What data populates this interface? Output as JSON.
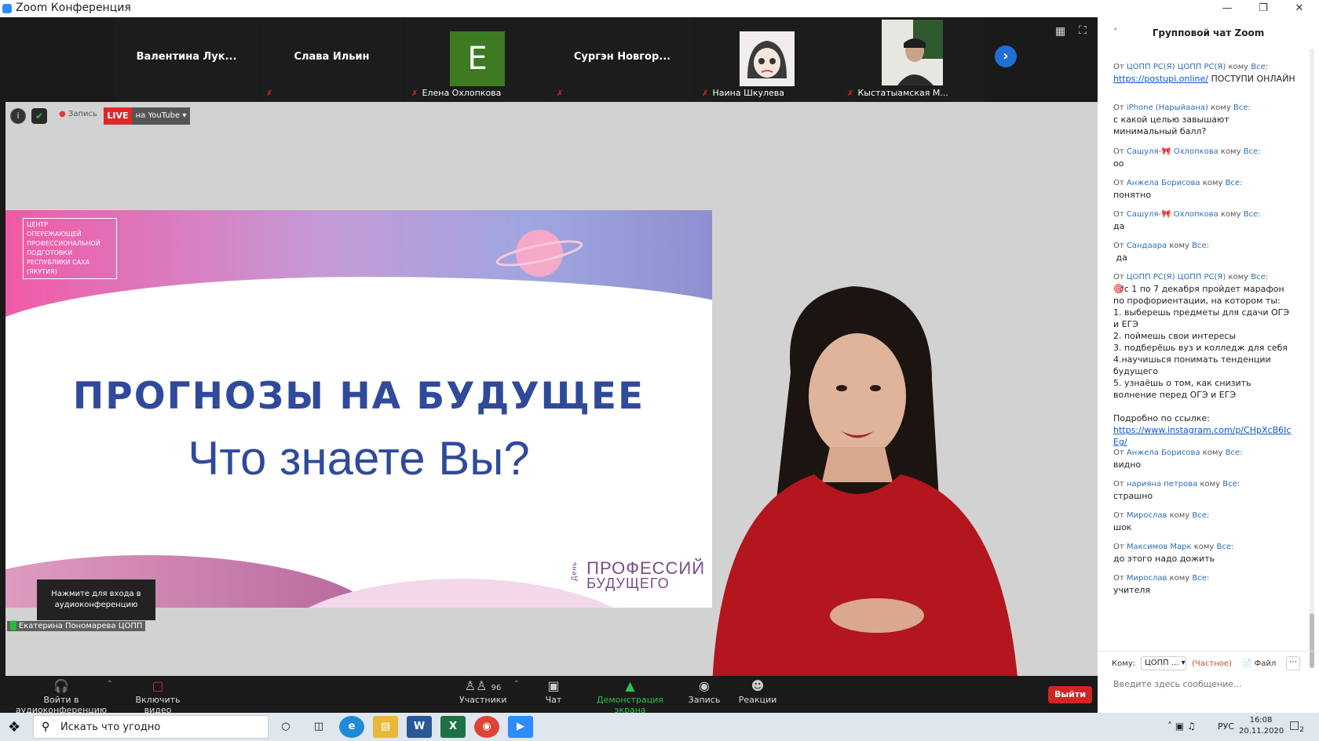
{
  "window": {
    "title": "Zoom Конференция"
  },
  "participants": [
    {
      "name": "Валентина Лук...",
      "label": "",
      "muted": false
    },
    {
      "name": "Слава Ильин",
      "label": "",
      "muted": true
    },
    {
      "name": "",
      "label": "Елена Охлопкова",
      "avatar_letter": "E",
      "muted": true
    },
    {
      "name": "Сургэн Новгор...",
      "label": "",
      "muted": true
    },
    {
      "name": "",
      "label": "Наина Шкулева",
      "muted": true
    },
    {
      "name": "",
      "label": "Кыстатыамская М...",
      "muted": true
    }
  ],
  "meeting_bar": {
    "record_label": "Запись",
    "live_label": "LIVE",
    "live_target": "на YouTube"
  },
  "slide": {
    "title": "ПРОГНОЗЫ НА БУДУЩЕЕ",
    "subtitle": "Что знаете Вы?",
    "logo_line1": "ПРОФЕССИЙ",
    "logo_line2": "БУДУЩЕГО",
    "logo_tag": "День"
  },
  "audio_tip": "Нажмите для входа в аудиоконференцию",
  "speaker_name": "Екатерина Пономарева ЦОПП",
  "toolbar": {
    "join_audio": "Войти в аудиоконференцию",
    "start_video": "Включить видео",
    "participants": "Участники",
    "participants_count": "96",
    "chat": "Чат",
    "share": "Демонстрация экрана",
    "record": "Запись",
    "reactions": "Реакции",
    "leave": "Выйти"
  },
  "chat": {
    "title": "Групповой чат Zoom",
    "to_label": "Кому:",
    "to_value": "ЦОПП ...",
    "private_label": "(Частное)",
    "file_label": "Файл",
    "placeholder": "Введите здесь сообщение...",
    "messages": [
      {
        "from": "ЦОПП РС(Я) ЦОПП РС(Я)",
        "link": "https://postupi.online/",
        "text": " ПОСТУПИ ОНЛАЙН"
      },
      {
        "from": "iPhone (Нарыйаана)",
        "text": "с какой целью завышают минимальный балл?"
      },
      {
        "from": "Сашуля-🎀 Охлопкова",
        "text": "оо"
      },
      {
        "from": "Анжела Борисова",
        "text": "понятно"
      },
      {
        "from": "Сашуля-🎀 Охлопкова",
        "text": "да"
      },
      {
        "from": "Сандаара",
        "text": " да"
      },
      {
        "from": "ЦОПП РС(Я) ЦОПП РС(Я)",
        "text": "🎯с 1 по 7 декабря пройдет марафон по профориентации, на котором ты:\n1. выберешь предметы для сдачи ОГЭ и ЕГЭ\n2. поймешь свои интересы\n3. подберёшь вуз и колледж для себя\n4.научишься понимать тенденции будущего\n5. узнаёшь о том, как снизить волнение перед ОГЭ и ЕГЭ\n\nПодробно по ссылке:",
        "link": "https://www.instagram.com/p/CHpXcB6IcEg/"
      },
      {
        "from": "Анжела Борисова",
        "text": "видно"
      },
      {
        "from": "нарияна петрова",
        "text": "страшно"
      },
      {
        "from": "Мирослав",
        "text": "шок"
      },
      {
        "from": "Максимов Марк",
        "text": "до этого надо дожить"
      },
      {
        "from": "Мирослав",
        "text": "учителя"
      }
    ],
    "from_prefix": "От",
    "to_prefix": "кому",
    "to_all": "Все:"
  },
  "taskbar": {
    "search_placeholder": "Искать что угодно",
    "lang": "РУС",
    "time": "16:08",
    "date": "20.11.2020",
    "notif_count": "2"
  }
}
